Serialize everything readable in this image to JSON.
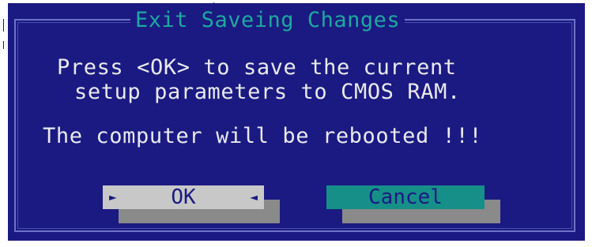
{
  "dialog": {
    "title": "Exit Saveing Changes",
    "message_line_1": "Press <OK> to save the current",
    "message_line_2": "setup parameters to CMOS RAM.",
    "message_line_3": "The computer will be rebooted !!!"
  },
  "buttons": {
    "ok": {
      "label": "OK",
      "left_marker": "►",
      "right_marker": "◄",
      "selected": true
    },
    "cancel": {
      "label": "Cancel",
      "selected": false
    }
  },
  "colors": {
    "dialog_background": "#1a1a82",
    "title_text": "#1fa8a0",
    "message_text": "#e9e9ee",
    "ok_button": "#c8c8c8",
    "cancel_button": "#168f88",
    "button_shadow": "#8a8a8a",
    "frame": "#6f72c6"
  }
}
